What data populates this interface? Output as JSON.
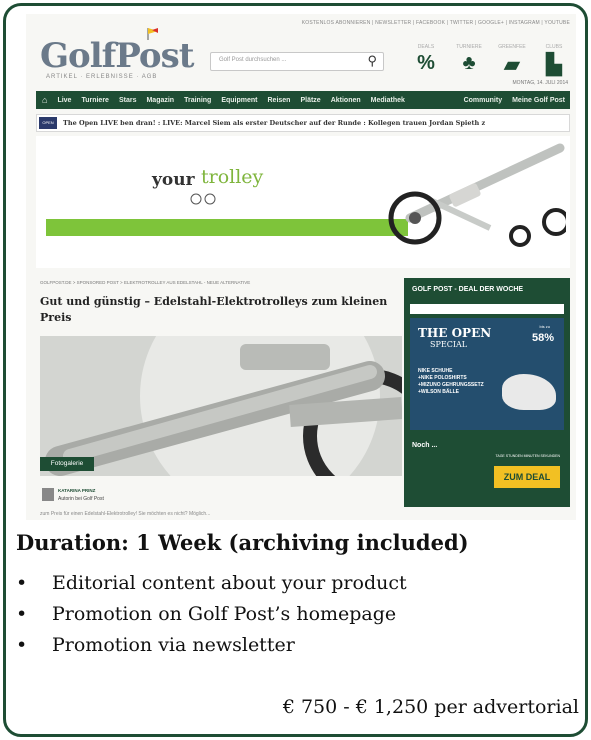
{
  "header": {
    "top_links": "KOSTENLOS ABONNIEREN | NEWSLETTER | FACEBOOK | TWITTER | GOOGLE+ | INSTAGRAM | YOUTUBE",
    "logo": "GolfPost",
    "logo_sub": "ARTIKEL · ERLEBNISSE · AGB",
    "search_placeholder": "Golf Post durchsuchen ...",
    "search_icon": "magnifier",
    "icons": [
      {
        "label": "DEALS",
        "symbol": "%",
        "name": "deals-icon"
      },
      {
        "label": "TURNIERE",
        "symbol": "♣",
        "name": "tournaments-icon"
      },
      {
        "label": "GREENFEE",
        "symbol": "▰",
        "name": "greenfee-icon"
      },
      {
        "label": "CLUBS",
        "symbol": "▙",
        "name": "clubs-icon"
      }
    ],
    "date": "MONTAG, 14. JULI 2014"
  },
  "nav": {
    "items": [
      "Live",
      "Turniere",
      "Stars",
      "Magazin",
      "Training",
      "Equipment",
      "Reisen",
      "Plätze",
      "Aktionen",
      "Mediathek"
    ],
    "right_items": [
      "Community",
      "Meine Golf Post"
    ]
  },
  "ticker": {
    "badge": "OPEN",
    "text": "The Open LIVE  ben dran! : LIVE: Marcel Siem als erster Deutscher auf der Runde : Kollegen trauen Jordan Spieth z"
  },
  "banner": {
    "brand_part1": "your",
    "brand_part2": "trolley",
    "bar_color": "#7ec43a"
  },
  "article": {
    "breadcrumb": "GOLFPOST.DE > SPONSORED POST > ELEKTROTROLLEY AUS EDELSTAHL - NEUE ALTERNATIVE",
    "title": "Gut und günstig – Edelstahl-Elektrotrolleys zum kleinen Preis",
    "gallery_button": "Fotogalerie",
    "author_name": "KATARINA PRINZ",
    "author_role": "Autorin bei Golf Post",
    "excerpt": "zum Preis für einen Edelstahl-Elektrotrolley! Sie möchten es nicht? Möglich..."
  },
  "deal": {
    "title": "GOLF POST - DEAL DER WOCHE",
    "open_line1": "THE OPEN",
    "open_line2": "SPECIAL",
    "percent_label": "bis zu",
    "percent": "58%",
    "lines": [
      "NIKE SCHUHE",
      "+NIKE POLOSHIRTS",
      "+MIZUNO GEHRUNGSSETZ",
      "+WILSON BÄLLE"
    ],
    "noch": "Noch ...",
    "countdown": "TAGE  STUNDEN  MINUTEN  SEKUNDEN",
    "button": "ZUM DEAL"
  },
  "offer": {
    "duration": "Duration: 1 Week (archiving included)",
    "bullets": [
      "Editorial content about your product",
      "Promotion on Golf Post’s homepage",
      "Promotion via newsletter"
    ],
    "price": "€ 750 - € 1,250 per advertorial"
  },
  "colors": {
    "frame": "#1e4d34",
    "nav": "#1e4d34",
    "accent_green": "#7ec43a",
    "deal_button": "#f2c023"
  }
}
